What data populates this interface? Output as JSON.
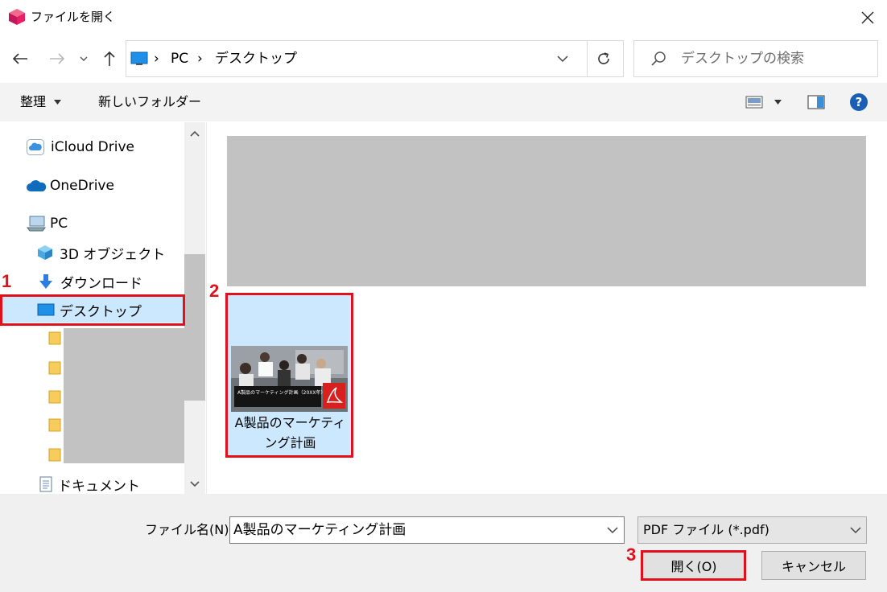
{
  "window": {
    "title": "ファイルを開く"
  },
  "address": {
    "crumbs": [
      "PC",
      "デスクトップ"
    ]
  },
  "search": {
    "placeholder": "デスクトップの検索"
  },
  "toolbar": {
    "organize_label": "整理",
    "new_folder_label": "新しいフォルダー"
  },
  "nav": {
    "items": [
      {
        "label": "iCloud Drive"
      },
      {
        "label": "OneDrive"
      },
      {
        "label": "PC"
      },
      {
        "label": "3D オブジェクト"
      },
      {
        "label": "ダウンロード"
      },
      {
        "label": "デスクトップ",
        "selected": true
      },
      {
        "label": "ドキュメント"
      }
    ]
  },
  "files": [
    {
      "name_line1": "A製品のマーケティ",
      "name_line2": "ング計画",
      "thumb_text": "A製品のマーケティング計画（20XX年）"
    }
  ],
  "footer": {
    "filename_label": "ファイル名(N):",
    "filename_value": "A製品のマーケティング計画",
    "filetype_value": "PDF ファイル (*.pdf)",
    "open_label": "開く(O)",
    "cancel_label": "キャンセル"
  },
  "steps": [
    "1",
    "2",
    "3"
  ],
  "colors": {
    "highlight": "#e0111a",
    "selection": "#cce8ff",
    "accent": "#0078d7"
  }
}
